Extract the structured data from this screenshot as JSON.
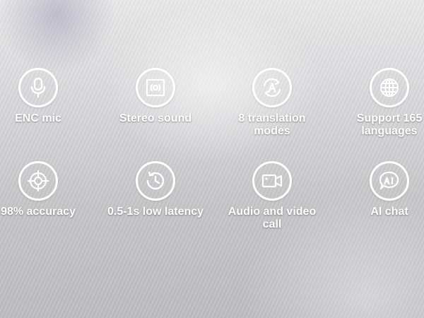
{
  "features": [
    {
      "icon": "microphone-icon",
      "label": "ENC mic"
    },
    {
      "icon": "speaker-icon",
      "label": "Stereo sound"
    },
    {
      "icon": "translate-icon",
      "label": "8 translation\nmodes"
    },
    {
      "icon": "globe-icon",
      "label": "Support 165\nlanguages"
    },
    {
      "icon": "crosshair-icon",
      "label": "98% accuracy"
    },
    {
      "icon": "clock-icon",
      "label": "0.5-1s low latency"
    },
    {
      "icon": "video-call-icon",
      "label": "Audio and video call"
    },
    {
      "icon": "ai-chat-icon",
      "label": "AI chat"
    }
  ],
  "colors": {
    "icon_stroke": "#ffffff",
    "label_text": "#ffffff"
  }
}
